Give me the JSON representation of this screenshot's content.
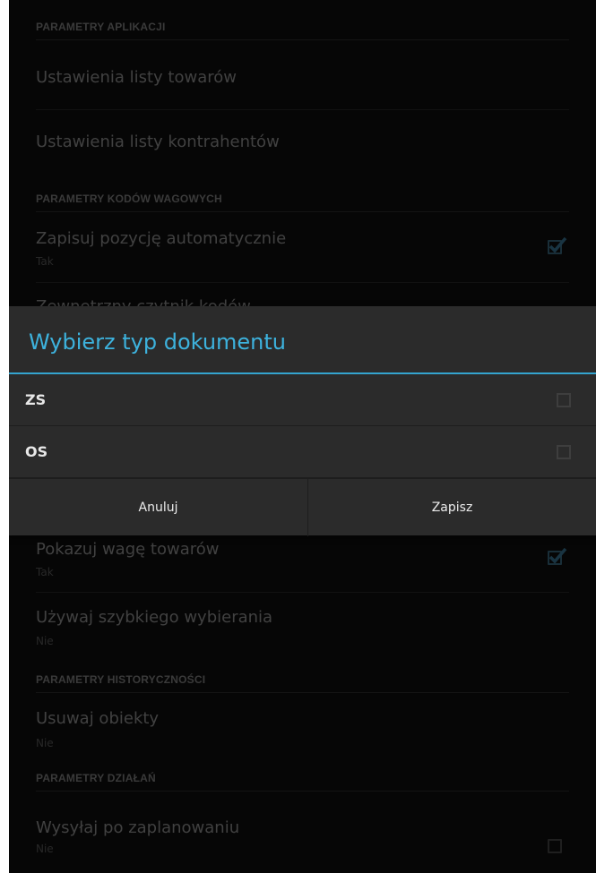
{
  "settings": {
    "section_app": "PARAMETRY APLIKACJI",
    "item_goods_list": "Ustawienia listy towarów",
    "item_contractors_list": "Ustawienia listy kontrahentów",
    "section_weight_codes": "PARAMETRY KODÓW WAGOWYCH",
    "item_auto_save": {
      "title": "Zapisuj pozycję automatycznie",
      "value": "Tak",
      "checked": true
    },
    "item_external_reader": {
      "title": "Zewnętrzny czytnik kodów"
    },
    "item_show_weight": {
      "title": "Pokazuj wagę towarów",
      "value": "Tak",
      "checked": true
    },
    "item_quick_dial": {
      "title": "Używaj szybkiego wybierania",
      "value": "Nie"
    },
    "section_history": "PARAMETRY HISTORYCZNOŚCI",
    "item_delete_objects": {
      "title": "Usuwaj obiekty",
      "value": "Nie"
    },
    "section_actions": "PARAMETRY DZIAŁAŃ",
    "item_send_after_plan": {
      "title": "Wysyłaj po zaplanowaniu",
      "value": "Nie",
      "checked": false
    }
  },
  "dialog": {
    "title": "Wybierz typ dokumentu",
    "options": [
      {
        "label": "ZS",
        "checked": false
      },
      {
        "label": "OS",
        "checked": false
      }
    ],
    "cancel_label": "Anuluj",
    "save_label": "Zapisz"
  },
  "colors": {
    "accent": "#3db2dd",
    "background": "#0b0b0b",
    "dialog_background": "#2b2b2b"
  }
}
